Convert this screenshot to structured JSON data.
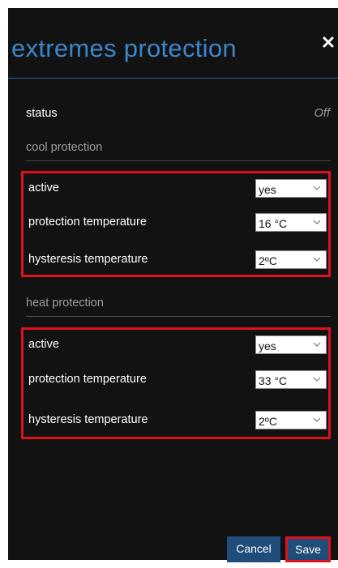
{
  "dialog": {
    "title": "extremes protection",
    "close_icon": "close-icon"
  },
  "status": {
    "label": "status",
    "value": "Off"
  },
  "cool_protection": {
    "title": "cool protection",
    "rows": [
      {
        "label": "active",
        "value": "yes"
      },
      {
        "label": "protection temperature",
        "value": "16 °C"
      },
      {
        "label": "hysteresis temperature",
        "value": "2ºC"
      }
    ]
  },
  "heat_protection": {
    "title": "heat protection",
    "rows": [
      {
        "label": "active",
        "value": "yes"
      },
      {
        "label": "protection temperature",
        "value": "33 °C"
      },
      {
        "label": "hysteresis temperature",
        "value": "2ºC"
      }
    ]
  },
  "buttons": {
    "cancel": "Cancel",
    "save": "Save"
  },
  "colors": {
    "background": "#121212",
    "title": "#3d86cc",
    "highlight": "#e0101c",
    "button": "#1f4c78"
  }
}
